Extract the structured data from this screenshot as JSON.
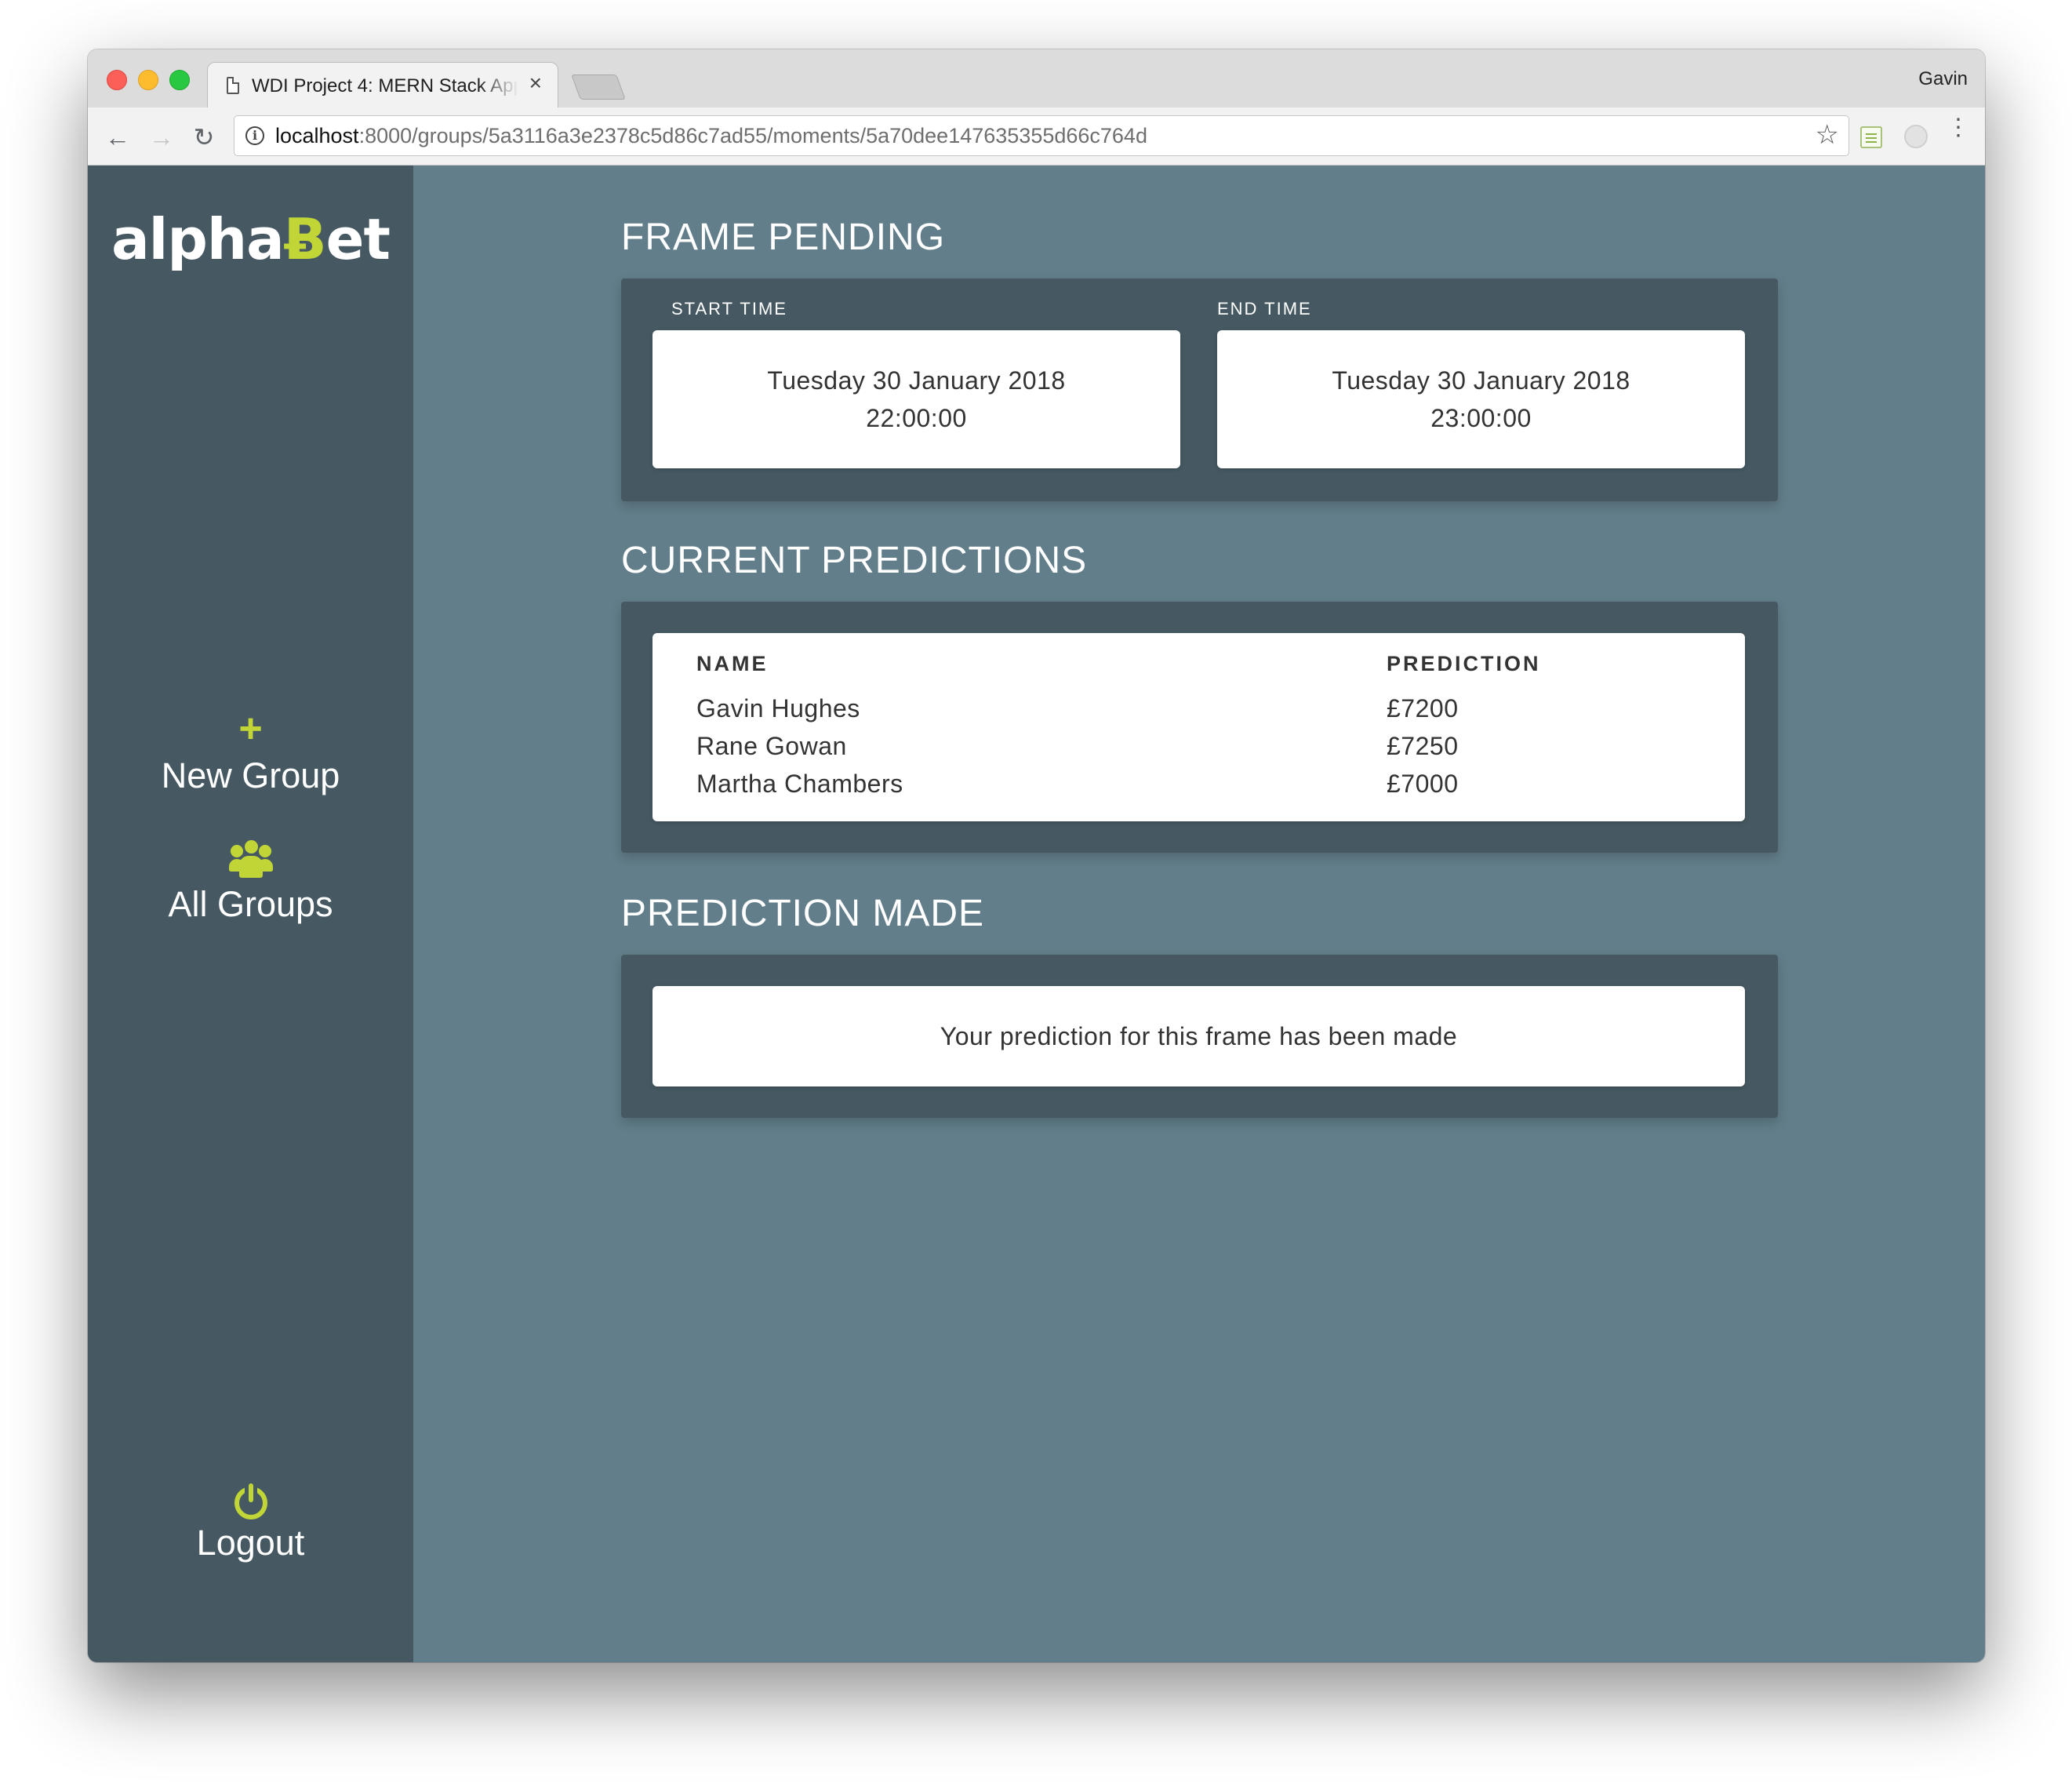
{
  "browser": {
    "tab_title": "WDI Project 4: MERN Stack App",
    "tab_close": "×",
    "profile_name": "Gavin",
    "url_host": "localhost",
    "url_path": ":8000/groups/5a3116a3e2378c5d86c7ad55/moments/5a70dee147635355d66c764d",
    "back": "←",
    "forward": "→",
    "reload": "↻",
    "bookmark": "☆",
    "info": "i",
    "menu": "⋮"
  },
  "sidebar": {
    "logo_prefix": "alpha",
    "logo_b": "Ƀ",
    "logo_suffix": "et",
    "new_group_icon": "+",
    "new_group_label": "New Group",
    "all_groups_label": "All Groups",
    "logout_label": "Logout",
    "icons": {
      "new_group": "plus-icon",
      "all_groups": "users-icon",
      "logout": "power-icon"
    },
    "accent_color": "#c1d636"
  },
  "frame": {
    "title": "FRAME PENDING",
    "start_label": "START TIME",
    "start_date": "Tuesday 30 January 2018",
    "start_time": "22:00:00",
    "end_label": "END TIME",
    "end_date": "Tuesday 30 January 2018",
    "end_time": "23:00:00"
  },
  "predictions": {
    "title": "CURRENT PREDICTIONS",
    "headers": [
      "NAME",
      "PREDICTION"
    ],
    "rows": [
      {
        "name": "Gavin Hughes",
        "prediction": "£7200"
      },
      {
        "name": "Rane Gowan",
        "prediction": "£7250"
      },
      {
        "name": "Martha Chambers",
        "prediction": "£7000"
      }
    ]
  },
  "made": {
    "title": "PREDICTION MADE",
    "message": "Your prediction for this frame has been made"
  },
  "colors": {
    "background": "#627e8a",
    "sidebar": "#465962",
    "panel": "#465962",
    "accent": "#c1d636"
  }
}
